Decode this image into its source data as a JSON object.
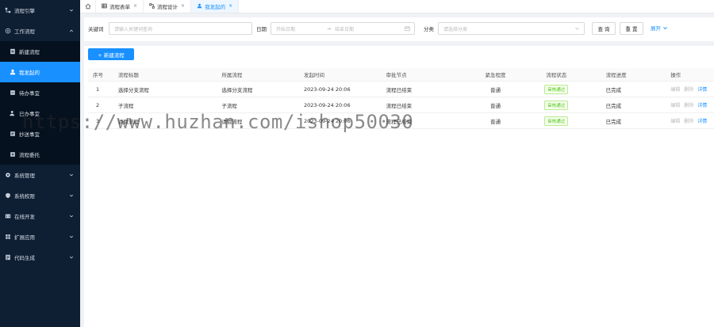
{
  "sidebar": {
    "items": [
      {
        "label": "流程引擎",
        "icon": "flow-icon",
        "expanded": false
      },
      {
        "label": "工作流程",
        "icon": "workflow-icon",
        "expanded": true
      },
      {
        "label": "系统管理",
        "icon": "settings-icon",
        "expanded": false
      },
      {
        "label": "系统权限",
        "icon": "shield-icon",
        "expanded": false
      },
      {
        "label": "在线开发",
        "icon": "code-icon",
        "expanded": false
      },
      {
        "label": "扩展应用",
        "icon": "puzzle-icon",
        "expanded": false
      },
      {
        "label": "代码生成",
        "icon": "generate-icon",
        "expanded": false
      }
    ],
    "sub_items": [
      {
        "label": "新建流程",
        "icon": "new-doc-icon",
        "active": false
      },
      {
        "label": "我发起的",
        "icon": "user-icon",
        "active": true
      },
      {
        "label": "待办事宜",
        "icon": "todo-icon",
        "active": false
      },
      {
        "label": "已办事宜",
        "icon": "done-icon",
        "active": false
      },
      {
        "label": "抄送事宜",
        "icon": "cc-icon",
        "active": false
      },
      {
        "label": "流程委托",
        "icon": "delegate-icon",
        "active": false
      }
    ]
  },
  "tabs": [
    {
      "label": "流程表单",
      "icon": "table-icon",
      "active": false
    },
    {
      "label": "流程设计",
      "icon": "design-icon",
      "active": false
    },
    {
      "label": "我发起的",
      "icon": "user-icon",
      "active": true
    }
  ],
  "filter": {
    "keyword_label": "关键词",
    "keyword_placeholder": "请输入关键词查询",
    "date_label": "日期",
    "start_placeholder": "开始日期",
    "date_separator": "→",
    "end_placeholder": "结束日期",
    "category_label": "分类",
    "category_placeholder": "请选择分类",
    "query_label": "查 询",
    "reset_label": "重 置",
    "expand_label": "展开"
  },
  "toolbar": {
    "new_label": "+ 新建流程"
  },
  "table": {
    "headers": [
      "序号",
      "流程标题",
      "所属流程",
      "发起时间",
      "审批节点",
      "紧急程度",
      "流程状态",
      "流程进度",
      "操作"
    ],
    "rows": [
      {
        "no": "1",
        "title": "选择分支流程",
        "flow": "选择分支流程",
        "time": "2023-09-24 20:06",
        "node": "流程已结束",
        "urgency": "普通",
        "status": "审核通过",
        "progress": "已完成"
      },
      {
        "no": "2",
        "title": "子流程",
        "flow": "子流程",
        "time": "2023-09-24 20:06",
        "node": "流程已结束",
        "urgency": "普通",
        "status": "审核通过",
        "progress": "已完成"
      },
      {
        "no": "3",
        "title": "请假流程",
        "flow": "请假流程",
        "time": "2023-09-24 20:06",
        "node": "流程已结束",
        "urgency": "普通",
        "status": "审核通过",
        "progress": "已完成"
      }
    ],
    "ops": [
      "编辑",
      "删除",
      "详情"
    ]
  },
  "watermark": "https://www.huzhan.com/ishop50030",
  "colors": {
    "primary": "#1890ff",
    "sidebar_bg": "#0e1e33",
    "success": "#52c41a"
  }
}
